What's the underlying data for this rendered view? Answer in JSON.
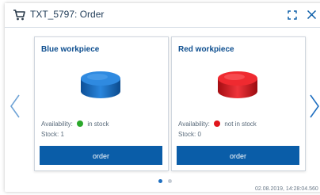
{
  "window": {
    "title": "TXT_5797: Order",
    "icons": [
      "cart-icon",
      "expand-icon",
      "close-icon"
    ]
  },
  "cards": [
    {
      "title": "Blue workpiece",
      "availability_label": "Availability:",
      "availability_status": "in stock",
      "availability_color": "#2ba82b",
      "stock_label": "Stock:",
      "stock_value": "1",
      "workpiece_color": "#1f72c8",
      "button_label": "order"
    },
    {
      "title": "Red workpiece",
      "availability_label": "Availability:",
      "availability_status": "not in stock",
      "availability_color": "#e0161c",
      "stock_label": "Stock:",
      "stock_value": "0",
      "workpiece_color": "#e01e26",
      "button_label": "order"
    }
  ],
  "carousel": {
    "icons": [
      "chevron-left-icon",
      "chevron-right-icon"
    ],
    "page_count": 2,
    "active_page": 1
  },
  "footer": {
    "timestamp": "02.08.2019, 14:28:04.560"
  },
  "colors": {
    "accent": "#0a5da8",
    "title_text": "#0d4e8f",
    "arrow": "#6fa3d6",
    "pager_active": "#1f6fc0",
    "pager_inactive": "#c5ccd4"
  }
}
